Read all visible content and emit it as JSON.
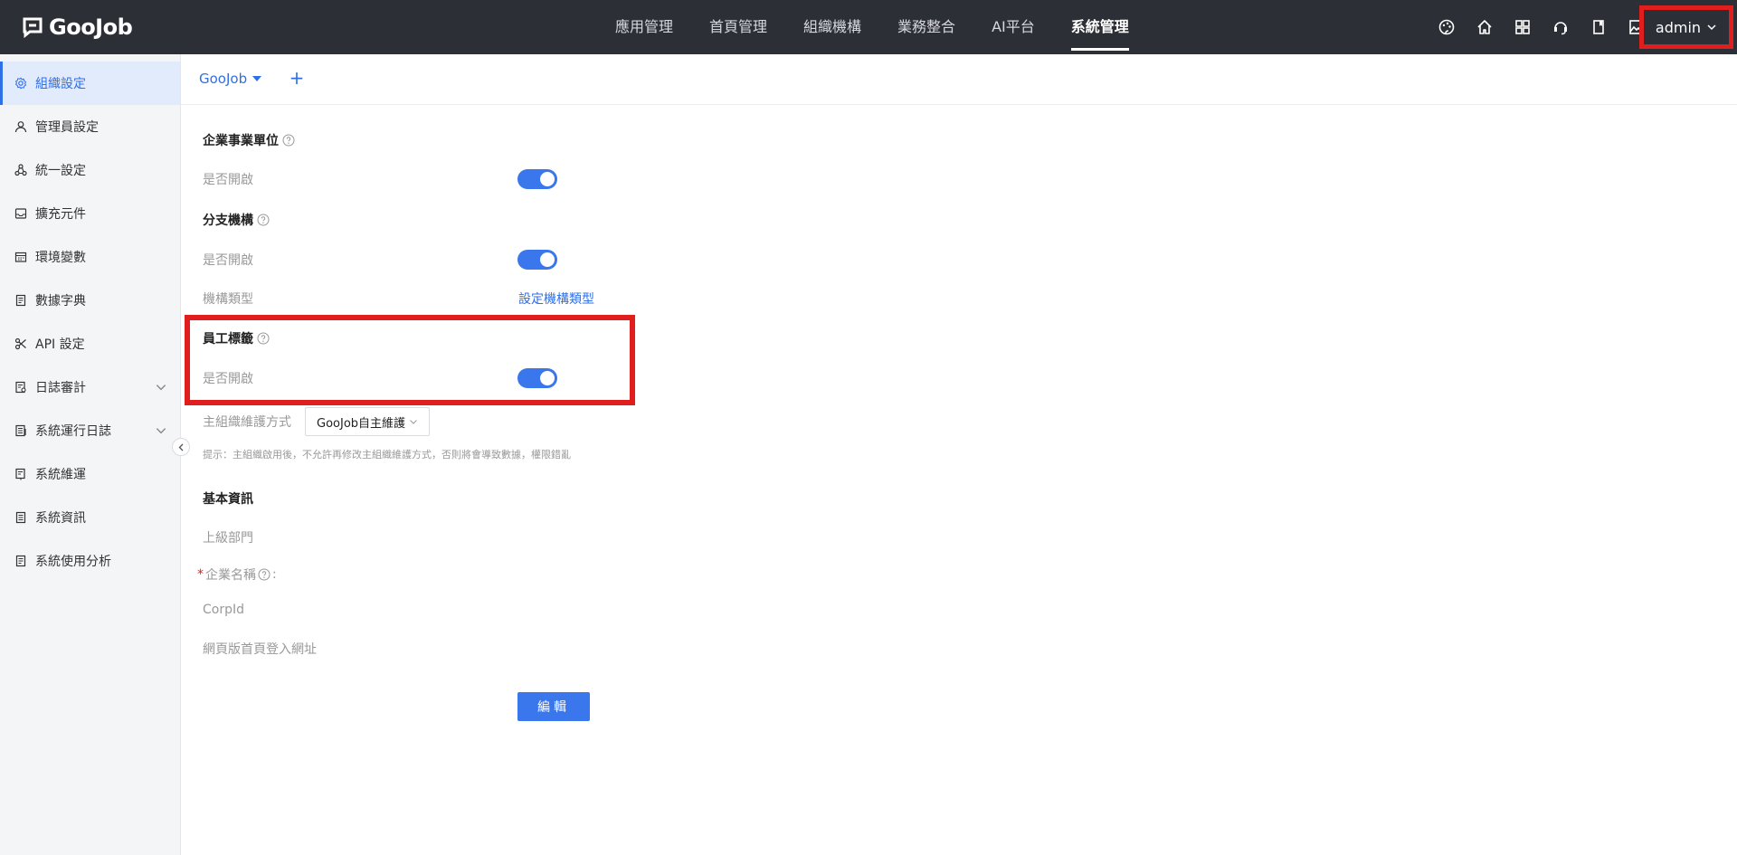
{
  "app": {
    "logo_text": "GooJob"
  },
  "topnav": {
    "items": [
      "應用管理",
      "首頁管理",
      "組織機構",
      "業務整合",
      "AI平台",
      "系統管理"
    ],
    "active": "系統管理"
  },
  "topbar_icons": [
    "palette-icon",
    "home-icon",
    "apps-grid-icon",
    "support-headset-icon",
    "book-icon",
    "image-icon"
  ],
  "user": {
    "name": "admin"
  },
  "sidebar": {
    "items": [
      {
        "label": "組織設定",
        "icon": "gear-icon",
        "active": true
      },
      {
        "label": "管理員設定",
        "icon": "user-icon"
      },
      {
        "label": "統一設定",
        "icon": "nodes-icon"
      },
      {
        "label": "擴充元件",
        "icon": "inbox-icon"
      },
      {
        "label": "環境變數",
        "icon": "calendar-icon"
      },
      {
        "label": "數據字典",
        "icon": "document-icon"
      },
      {
        "label": "API 設定",
        "icon": "scissors-icon"
      },
      {
        "label": "日誌審計",
        "icon": "audit-icon",
        "expandable": true
      },
      {
        "label": "系統運行日誌",
        "icon": "log-icon",
        "expandable": true
      },
      {
        "label": "系統維運",
        "icon": "maintenance-icon"
      },
      {
        "label": "系統資訊",
        "icon": "info-doc-icon"
      },
      {
        "label": "系統使用分析",
        "icon": "analysis-icon"
      }
    ]
  },
  "tabs": {
    "current": "GooJob"
  },
  "form": {
    "enterprise_unit": {
      "title": "企業事業單位",
      "enable_label": "是否開啟",
      "enabled": true
    },
    "branch": {
      "title": "分支機構",
      "enable_label": "是否開啟",
      "enabled": true,
      "type_label": "機構類型",
      "type_link": "設定機構類型"
    },
    "employee_tags": {
      "title": "員工標籤",
      "enable_label": "是否開啟",
      "enabled": true
    },
    "main_org": {
      "label": "主組織維護方式",
      "value": "GooJob自主維護"
    },
    "hint": "提示：主組織啟用後，不允許再修改主組織維護方式，否則將會導致數據，權限錯亂",
    "basic_info": {
      "title": "基本資訊",
      "parent_dept_label": "上級部門",
      "required_mark": "*",
      "company_name_label": "企業名稱",
      "company_name_suffix": ":",
      "corpid_label": "CorpId",
      "web_login_label": "網頁版首頁登入網址"
    },
    "edit_button": "編輯"
  },
  "colors": {
    "accent": "#3a77ec",
    "topbar_bg": "#2d2f36",
    "highlight": "#e01e1e"
  }
}
